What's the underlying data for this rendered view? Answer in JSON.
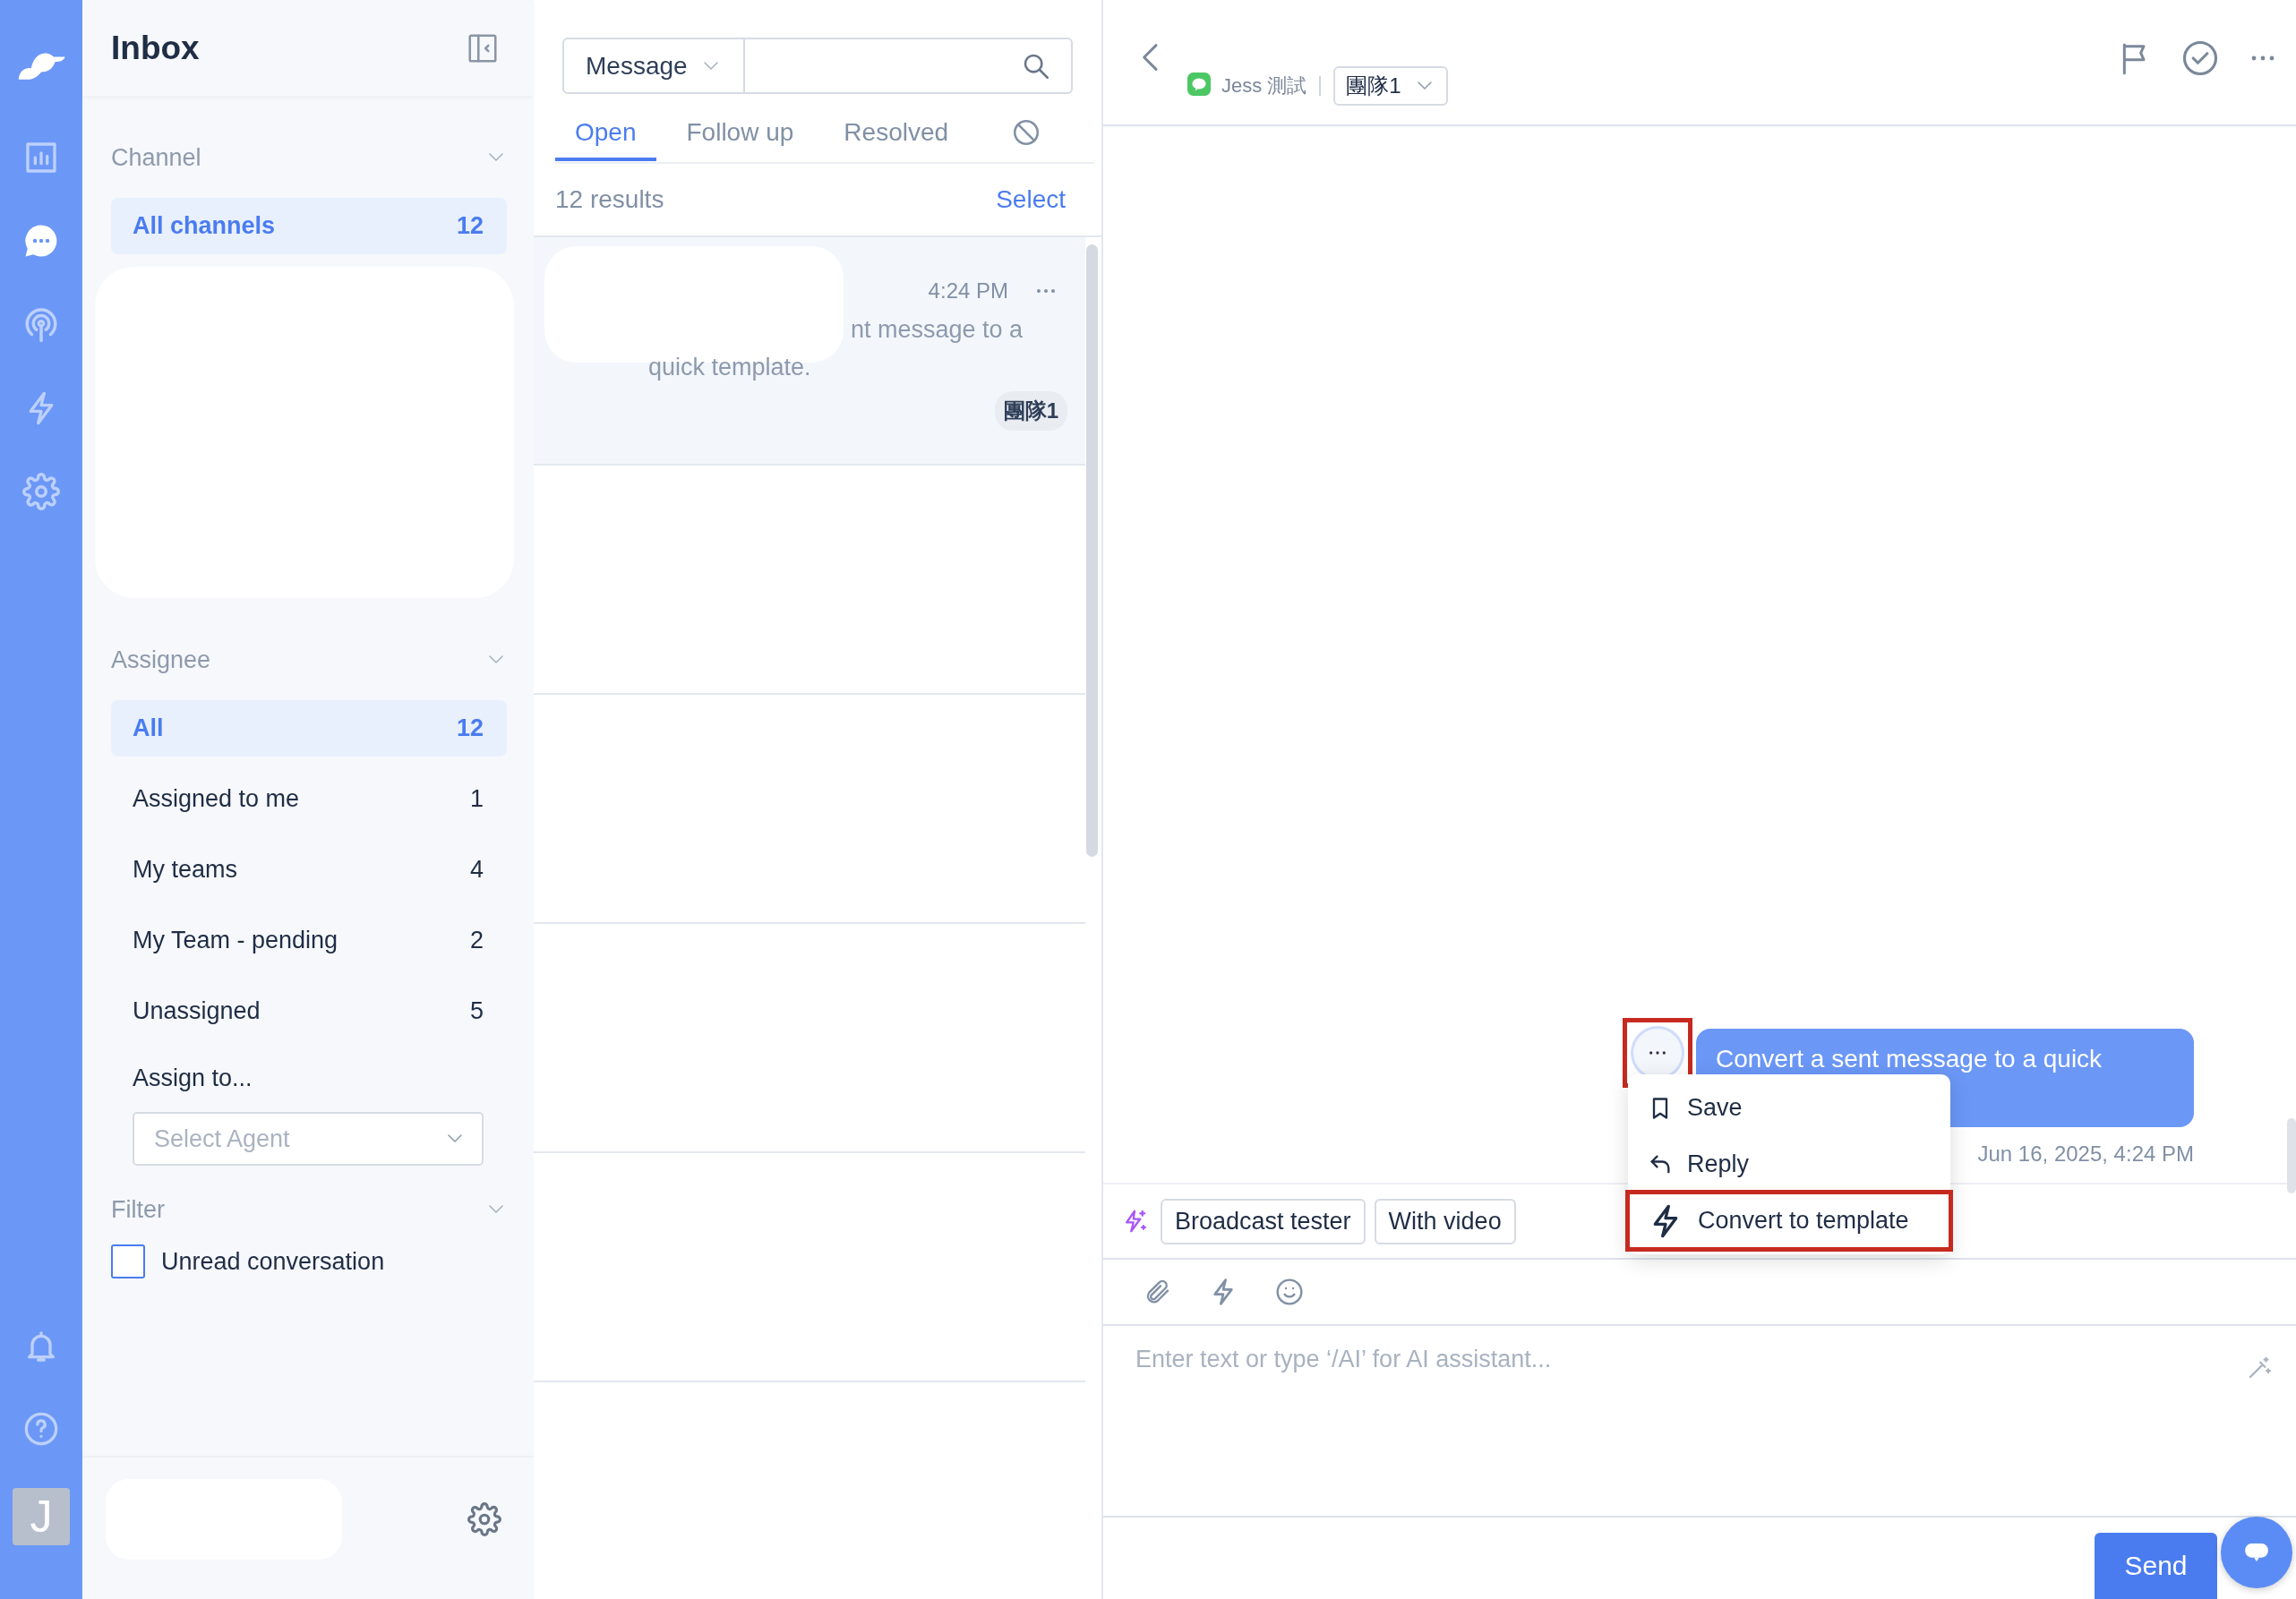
{
  "rail": {
    "items": [
      {
        "kind": "logo"
      },
      {
        "kind": "chart",
        "selected": false
      },
      {
        "kind": "chat",
        "selected": true
      },
      {
        "kind": "broadcast",
        "selected": false
      },
      {
        "kind": "bolt",
        "selected": false
      },
      {
        "kind": "gear",
        "selected": false
      }
    ],
    "bottom": [
      {
        "kind": "bell"
      },
      {
        "kind": "help"
      }
    ],
    "avatar": "J"
  },
  "sidebar": {
    "title": "Inbox",
    "channel": {
      "title": "Channel",
      "expanded": true,
      "items": [
        {
          "label": "All channels",
          "count": "12",
          "selected": true
        }
      ]
    },
    "assignee": {
      "title": "Assignee",
      "expanded": true,
      "items": [
        {
          "label": "All",
          "count": "12",
          "selected": true
        },
        {
          "label": "Assigned to me",
          "count": "1",
          "selected": false
        },
        {
          "label": "My teams",
          "count": "4",
          "selected": false
        },
        {
          "label": "My Team - pending",
          "count": "2",
          "selected": false
        },
        {
          "label": "Unassigned",
          "count": "5",
          "selected": false
        }
      ],
      "assign_label": "Assign to...",
      "agent_select": {
        "placeholder": "Select Agent"
      }
    },
    "filter": {
      "title": "Filter",
      "expanded": true,
      "options": [
        {
          "label": "Unread conversation",
          "checked": false
        }
      ]
    }
  },
  "list": {
    "search": {
      "scope": "Message"
    },
    "tabs": [
      {
        "kind": "text",
        "label": "Open",
        "selected": true
      },
      {
        "kind": "text",
        "label": "Follow up",
        "selected": false
      },
      {
        "kind": "text",
        "label": "Resolved",
        "selected": false
      },
      {
        "kind": "blocked",
        "selected": false
      }
    ],
    "results": "12 results",
    "select": "Select",
    "conversations": [
      {
        "time": "4:24 PM",
        "preview": [
          "nt message to a",
          "quick template."
        ],
        "tag": "團隊1",
        "selected": true
      }
    ]
  },
  "chat": {
    "contact": "Jess 測試",
    "team": "團隊1",
    "messages": [
      {
        "text": "Convert a sent message to a quick",
        "time": "Jun 16, 2025, 4:24 PM",
        "actions_highlighted": true
      }
    ],
    "menu": [
      {
        "kind": "bookmark",
        "label": "Save",
        "highlighted": false
      },
      {
        "kind": "reply",
        "label": "Reply",
        "highlighted": false
      },
      {
        "kind": "bolt",
        "label": "Convert to template",
        "highlighted": true
      }
    ],
    "quick_replies": [
      "Broadcast tester",
      "With video"
    ],
    "composer": {
      "placeholder": "Enter text or type ‘/AI’ for AI assistant..."
    },
    "send": "Send"
  }
}
